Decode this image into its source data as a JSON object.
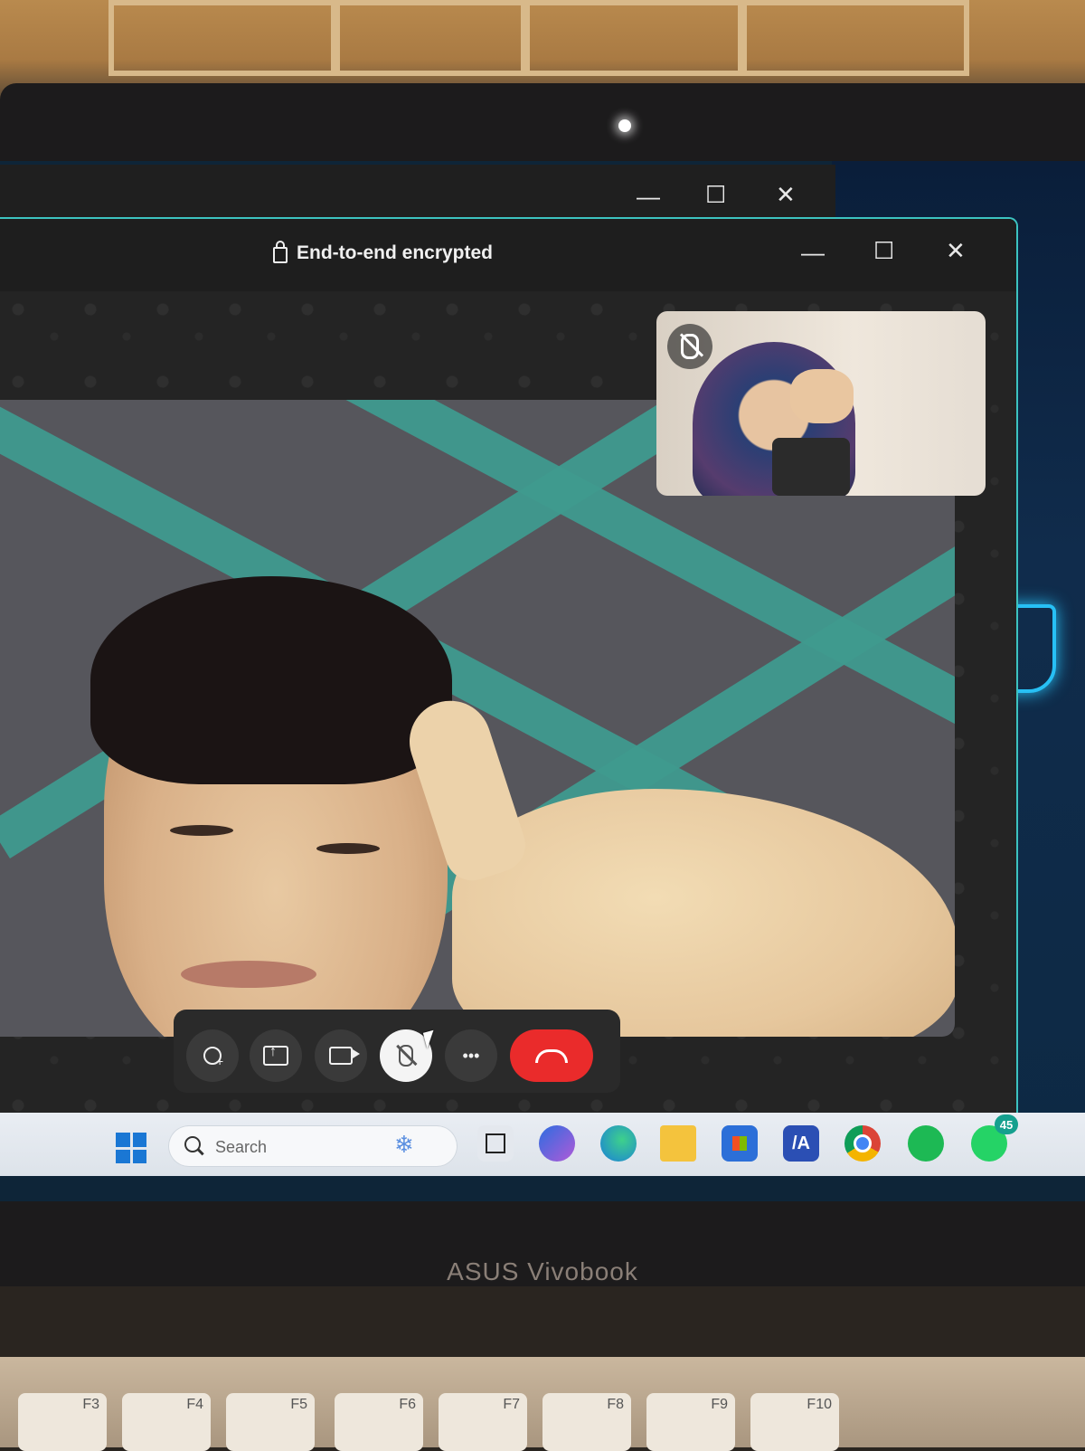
{
  "window": {
    "title": "End-to-end encrypted",
    "controls": {
      "minimize": "—",
      "maximize": "☐",
      "close": "✕"
    }
  },
  "back_window": {
    "controls": {
      "minimize": "—",
      "maximize": "☐",
      "close": "✕"
    }
  },
  "call": {
    "self_view_muted": true,
    "buttons": [
      {
        "name": "add-participant",
        "icon": "add-person-icon"
      },
      {
        "name": "share-screen",
        "icon": "share-screen-icon"
      },
      {
        "name": "camera",
        "icon": "video-icon"
      },
      {
        "name": "mute",
        "icon": "mic-off-icon",
        "state": "active"
      },
      {
        "name": "more",
        "label": "•••",
        "icon": "more-icon"
      },
      {
        "name": "end-call",
        "icon": "hangup-icon"
      }
    ]
  },
  "taskbar": {
    "search_placeholder": "Search",
    "apps": [
      {
        "name": "task-view",
        "icon": "task-view-icon"
      },
      {
        "name": "copilot",
        "icon": "copilot-icon"
      },
      {
        "name": "edge",
        "icon": "edge-icon"
      },
      {
        "name": "file-explorer",
        "icon": "folder-icon"
      },
      {
        "name": "store",
        "icon": "store-icon"
      },
      {
        "name": "app-a",
        "label": "/A",
        "icon": "app-icon"
      },
      {
        "name": "chrome",
        "icon": "chrome-icon"
      },
      {
        "name": "spotify",
        "icon": "spotify-icon"
      },
      {
        "name": "whatsapp",
        "icon": "whatsapp-icon",
        "badge": "45"
      }
    ]
  },
  "device": {
    "brand": "ASUS Vivobook",
    "keys": [
      "F3",
      "F4",
      "F5",
      "F6",
      "F7",
      "F8",
      "F9",
      "F10"
    ]
  },
  "colors": {
    "accent_border": "#3cc3c0",
    "end_call": "#ea2b2b",
    "windows_blue": "#1a77d4"
  }
}
